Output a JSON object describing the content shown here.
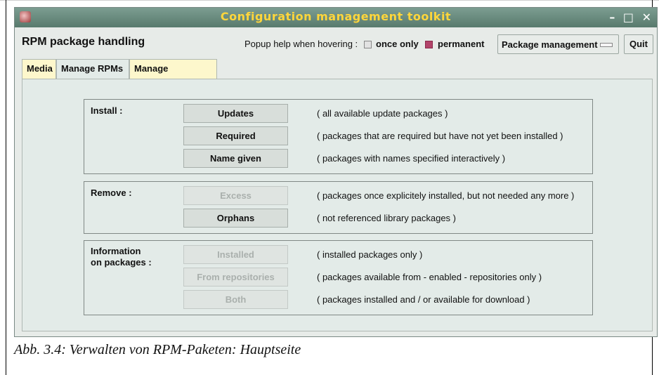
{
  "window": {
    "title": "Configuration management toolkit",
    "controls": [
      "–",
      "□",
      "✕"
    ]
  },
  "header": {
    "title": "RPM package handling",
    "popup_help_label": "Popup help when hovering :",
    "option_once": "once only",
    "option_permanent": "permanent",
    "package_select": "Package management",
    "quit_label": "Quit"
  },
  "tabs": [
    {
      "label": "Media"
    },
    {
      "label": "Manage RPMs"
    },
    {
      "label": "Manage programs"
    }
  ],
  "groups": [
    {
      "label": "Install :",
      "rows": [
        {
          "button": "Updates",
          "desc": "( all available update packages )",
          "enabled": true
        },
        {
          "button": "Required",
          "desc": "( packages that are required but have not yet been installed )",
          "enabled": true
        },
        {
          "button": "Name given",
          "desc": "( packages with names specified interactively )",
          "enabled": true
        }
      ]
    },
    {
      "label": "Remove :",
      "rows": [
        {
          "button": "Excess",
          "desc": "( packages once explicitely installed, but not needed any more )",
          "enabled": false
        },
        {
          "button": "Orphans",
          "desc": "( not referenced library packages )",
          "enabled": true
        }
      ]
    },
    {
      "label_line1": "Information",
      "label_line2": "on packages :",
      "rows": [
        {
          "button": "Installed",
          "desc": "( installed packages only )",
          "enabled": false
        },
        {
          "button": "From repositories",
          "desc": "( packages available from - enabled - repositories only )",
          "enabled": false
        },
        {
          "button": "Both",
          "desc": "( packages installed and / or available for download )",
          "enabled": false
        }
      ]
    }
  ],
  "caption": "Abb. 3.4: Verwalten von RPM-Paketen: Hauptseite",
  "colors": {
    "titlebar": "#6a8c7f",
    "title_text": "#ffd63b",
    "tab_inactive": "#fdf7cc",
    "permanent_checked": "#b2446a"
  }
}
